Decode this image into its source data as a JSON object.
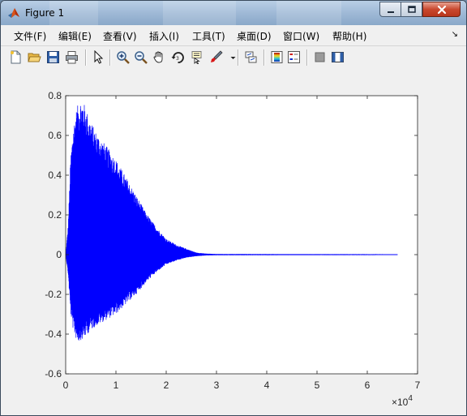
{
  "window": {
    "title": "Figure 1"
  },
  "menu": {
    "items": [
      {
        "label": "文件(F)"
      },
      {
        "label": "编辑(E)"
      },
      {
        "label": "查看(V)"
      },
      {
        "label": "插入(I)"
      },
      {
        "label": "工具(T)"
      },
      {
        "label": "桌面(D)"
      },
      {
        "label": "窗口(W)"
      },
      {
        "label": "帮助(H)"
      }
    ]
  },
  "toolbar": {
    "icons": [
      "new-figure-icon",
      "open-file-icon",
      "save-icon",
      "print-icon",
      "edit-plot-arrow-icon",
      "zoom-in-icon",
      "zoom-out-icon",
      "pan-hand-icon",
      "rotate-3d-icon",
      "data-cursor-icon",
      "brush-icon",
      "link-plot-icon",
      "colorbar-icon",
      "legend-icon",
      "hide-plot-tools-icon",
      "show-plot-tools-icon"
    ]
  },
  "colors": {
    "signal": "#0000ff",
    "axes_bg": "#ffffff",
    "figure_bg": "#f0f0f0"
  },
  "chart_data": {
    "type": "line",
    "title": "",
    "xlabel": "",
    "ylabel": "",
    "x_exponent_label": "×10",
    "x_exponent_power": "4",
    "xlim": [
      0,
      7
    ],
    "ylim": [
      -0.6,
      0.8
    ],
    "x_ticks": [
      0,
      1,
      2,
      3,
      4,
      5,
      6,
      7
    ],
    "x_tick_labels": [
      "0",
      "1",
      "2",
      "3",
      "4",
      "5",
      "6",
      "7"
    ],
    "y_ticks": [
      0.8,
      0.6,
      0.4,
      0.2,
      0,
      -0.2,
      -0.4,
      -0.6
    ],
    "y_tick_labels": [
      "0.8",
      "0.6",
      "0.4",
      "0.2",
      "0",
      "-0.2",
      "-0.4",
      "-0.6"
    ],
    "grid": false,
    "series": [
      {
        "envelope_upper": {
          "x": [
            0,
            0.05,
            0.1,
            0.15,
            0.2,
            0.25,
            0.3,
            0.35,
            0.4,
            0.5,
            0.6,
            0.8,
            1.0,
            1.2,
            1.4,
            1.6,
            1.8,
            2.0,
            2.2,
            2.4,
            2.6,
            2.8,
            3.0,
            6.6
          ],
          "y": [
            0,
            0.15,
            0.5,
            0.64,
            0.72,
            0.76,
            0.78,
            0.77,
            0.74,
            0.67,
            0.62,
            0.55,
            0.48,
            0.39,
            0.3,
            0.21,
            0.14,
            0.08,
            0.05,
            0.03,
            0.01,
            0.005,
            0.003,
            0.002
          ]
        },
        "envelope_lower": {
          "x": [
            0,
            0.05,
            0.1,
            0.15,
            0.2,
            0.25,
            0.3,
            0.35,
            0.4,
            0.5,
            0.6,
            0.8,
            1.0,
            1.2,
            1.4,
            1.6,
            1.8,
            2.0,
            2.2,
            2.4,
            2.6,
            2.8,
            3.0,
            6.6
          ],
          "y": [
            0,
            -0.1,
            -0.3,
            -0.38,
            -0.42,
            -0.44,
            -0.43,
            -0.43,
            -0.41,
            -0.38,
            -0.36,
            -0.33,
            -0.3,
            -0.25,
            -0.2,
            -0.14,
            -0.09,
            -0.05,
            -0.03,
            -0.015,
            -0.008,
            -0.004,
            -0.003,
            -0.002
          ]
        },
        "x_end": 6.6
      }
    ]
  }
}
